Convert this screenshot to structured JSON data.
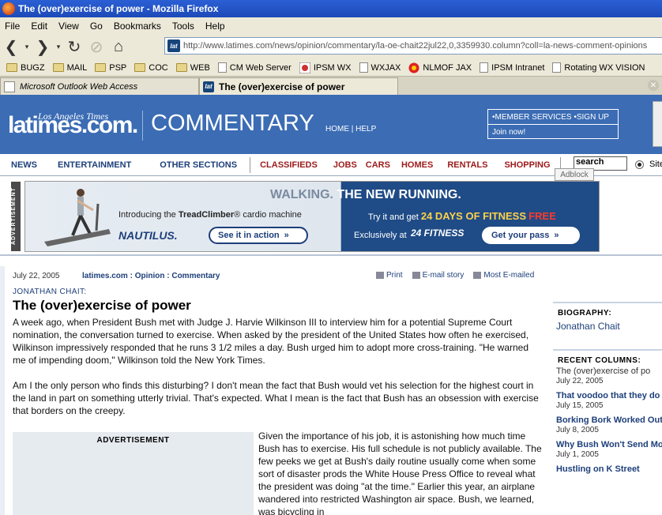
{
  "window": {
    "title": "The (over)exercise of power - Mozilla Firefox"
  },
  "menu": [
    "File",
    "Edit",
    "View",
    "Go",
    "Bookmarks",
    "Tools",
    "Help"
  ],
  "url": "http://www.latimes.com/news/opinion/commentary/la-oe-chait22jul22,0,3359930.column?coll=la-news-comment-opinions",
  "bookmarks": [
    {
      "label": "BUGZ",
      "type": "folder"
    },
    {
      "label": "MAIL",
      "type": "folder"
    },
    {
      "label": "PSP",
      "type": "folder"
    },
    {
      "label": "COC",
      "type": "folder"
    },
    {
      "label": "WEB",
      "type": "folder"
    },
    {
      "label": "CM Web Server",
      "type": "page"
    },
    {
      "label": "IPSM WX",
      "type": "site"
    },
    {
      "label": "WXJAX",
      "type": "page"
    },
    {
      "label": "NLMOF JAX",
      "type": "site"
    },
    {
      "label": "IPSM Intranet",
      "type": "page"
    },
    {
      "label": "Rotating WX VISION",
      "type": "page"
    }
  ],
  "tabs": [
    {
      "label": "Microsoft Outlook Web Access",
      "active": false
    },
    {
      "label": "The (over)exercise of power",
      "active": true
    }
  ],
  "header": {
    "logo_top": "Los Angeles Times",
    "logo": "latimes.com.",
    "section": "COMMENTARY",
    "links": "HOME | HELP",
    "member_services": "•MEMBER SERVICES •SIGN UP",
    "join": "Join now!"
  },
  "nav": {
    "primary": [
      "NEWS",
      "ENTERTAINMENT",
      "OTHER SECTIONS"
    ],
    "classifieds": [
      "CLASSIFIEDS",
      "JOBS",
      "CARS",
      "HOMES",
      "RENTALS",
      "SHOPPING"
    ],
    "search_value": "search",
    "site_label": "Site",
    "adblock": "Adblock"
  },
  "banner": {
    "label": "ADVERTISEMENT",
    "walking": "WALKING.",
    "new_running": "THE NEW RUNNING.",
    "intro_a": "Introducing the ",
    "intro_b": "TreadClimber",
    "intro_c": "® cardio machine",
    "nautilus": "NAUTILUS.",
    "see_it": "See it in action",
    "try_a": "Try it and get ",
    "try_days": "24 DAYS OF FITNESS",
    "try_free": "FREE",
    "exclusively": "Exclusively at",
    "fitness24": "24 FITNESS",
    "get_pass": "Get your pass"
  },
  "article": {
    "date": "July 22, 2005",
    "crumb": "latimes.com : Opinion : Commentary",
    "print": "Print",
    "email": "E-mail story",
    "most_emailed": "Most E-mailed",
    "kicker": "JONATHAN CHAIT:",
    "headline": "The (over)exercise of power",
    "p1": "A week ago, when President Bush met with Judge J. Harvie Wilkinson III to interview him for a potential Supreme Court nomination, the conversation turned to exercise. When asked by the president of the United States how often he exercised, Wilkinson impressively responded that he runs 3 1/2 miles a day. Bush urged him to adopt more cross-training. \"He warned me of impending doom,\" Wilkinson told the New York Times.",
    "p2": "Am I the only person who finds this disturbing? I don't mean the fact that Bush would vet his selection for the highest court in the land in part on something utterly trivial. That's expected. What I mean is the fact that Bush has an obsession with exercise that borders on the creepy.",
    "inline_ad": "ADVERTISEMENT",
    "p3": "Given the importance of his job, it is astonishing how much time Bush has to exercise. His full schedule is not publicly available. The few peeks we get at Bush's daily routine usually come when some sort of disaster prods the White House Press Office to reveal what the president was doing \"at the time.\" Earlier this year, an airplane wandered into restricted Washington air space. Bush, we learned, was bicycling in"
  },
  "sidebar": {
    "bio_head": "BIOGRAPHY:",
    "bio_link": "Jonathan Chait",
    "recent_head": "RECENT COLUMNS:",
    "columns": [
      {
        "title": "The (over)exercise of po",
        "date": "July 22, 2005"
      },
      {
        "title": "That voodoo that they do",
        "date": "July 15, 2005"
      },
      {
        "title": "Borking Bork Worked Out",
        "date": "July 8, 2005"
      },
      {
        "title": "Why Bush Won't Send Mo",
        "date": "July 1, 2005"
      },
      {
        "title": "Hustling on K Street",
        "date": ""
      }
    ]
  }
}
